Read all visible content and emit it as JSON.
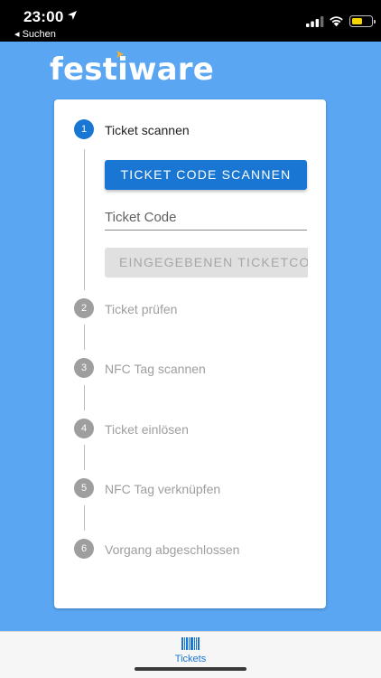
{
  "status_bar": {
    "time": "23:00",
    "back_label": "◂ Suchen",
    "battery_level": 0.55,
    "battery_color": "#f7d500"
  },
  "app": {
    "logo_text": "festiware",
    "background_color": "#5aa6f2",
    "accent_color": "#1976d2"
  },
  "stepper": {
    "active_step": 1,
    "steps": [
      {
        "number": "1",
        "label": "Ticket scannen"
      },
      {
        "number": "2",
        "label": "Ticket prüfen"
      },
      {
        "number": "3",
        "label": "NFC Tag scannen"
      },
      {
        "number": "4",
        "label": "Ticket einlösen"
      },
      {
        "number": "5",
        "label": "NFC Tag verknüpfen"
      },
      {
        "number": "6",
        "label": "Vorgang abgeschlossen"
      }
    ],
    "scan_button_label": "TICKET CODE SCANNEN",
    "code_field": {
      "placeholder": "Ticket Code",
      "value": ""
    },
    "submit_button_label": "EINGEGEBENEN TICKETCODE"
  },
  "tabbar": {
    "tabs": [
      {
        "label": "Tickets",
        "icon": "barcode-icon",
        "selected": true
      }
    ]
  }
}
